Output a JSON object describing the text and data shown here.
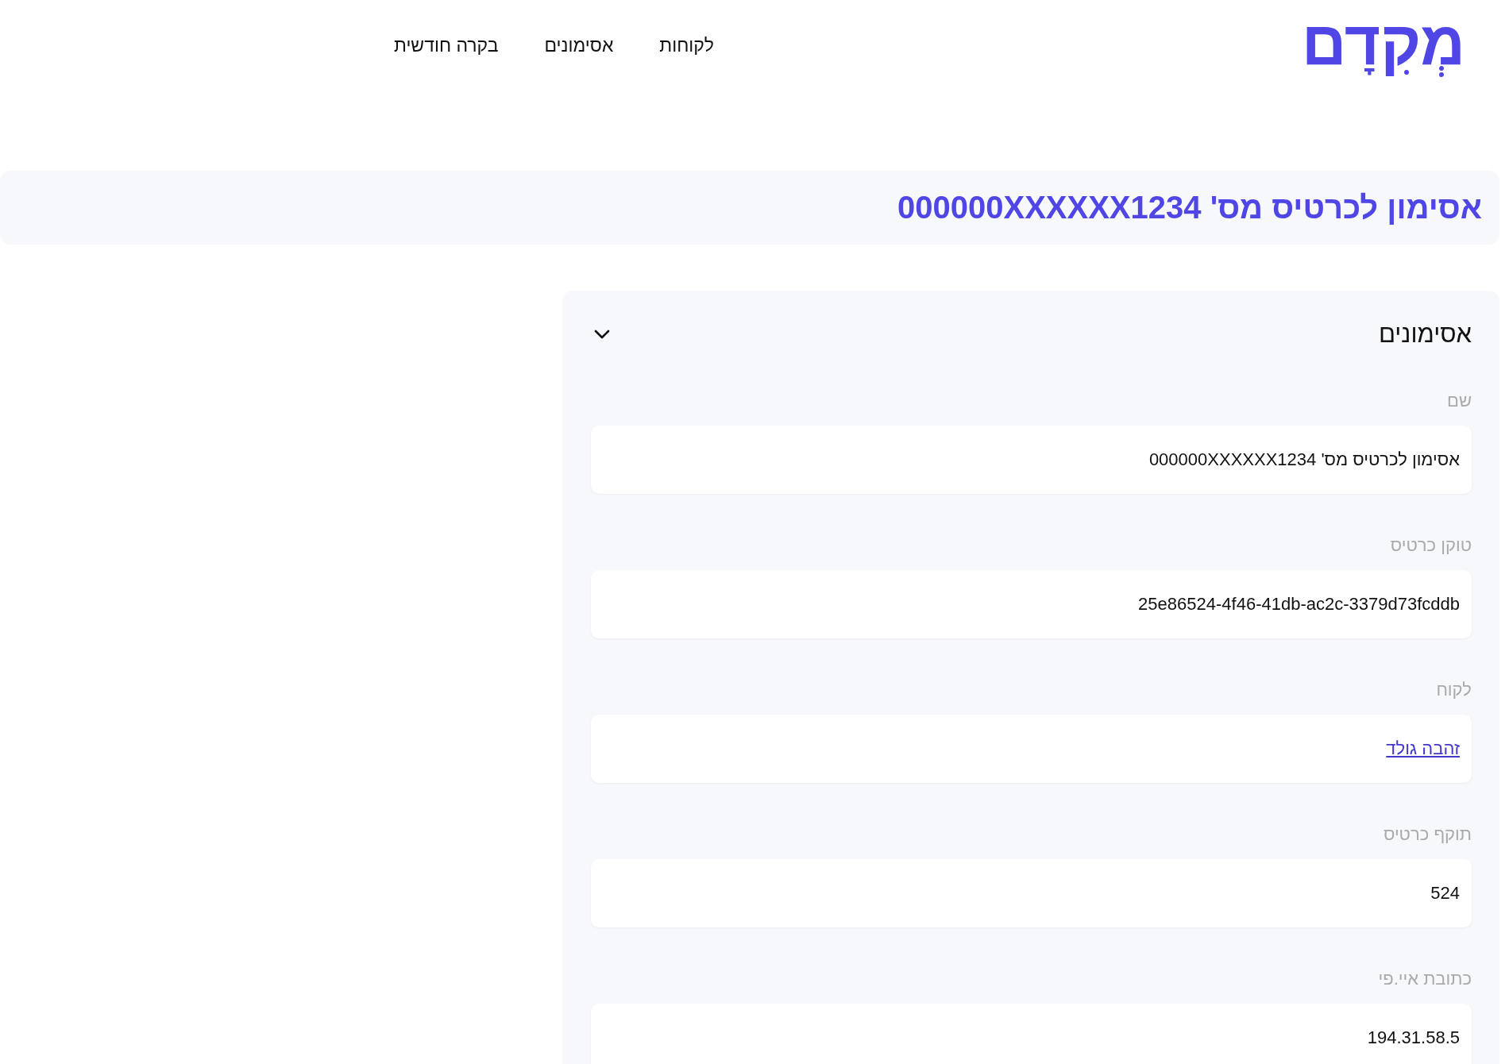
{
  "logo": {
    "text": "מְקִדָם"
  },
  "nav": [
    {
      "label": "לקוחות"
    },
    {
      "label": "אסימונים"
    },
    {
      "label": "בקרה חודשית"
    }
  ],
  "page_title": "אסימון לכרטיס מס' 000000XXXXXX1234",
  "panel": {
    "title": "אסימונים",
    "expanded": true,
    "fields": [
      {
        "kind": "text",
        "label": "שם",
        "value": "אסימון לכרטיס מס' 000000XXXXXX1234"
      },
      {
        "kind": "text",
        "label": "טוקן כרטיס",
        "value": "25e86524-4f46-41db-ac2c-3379d73fcddb"
      },
      {
        "kind": "link",
        "label": "לקוח",
        "value": "זהבה גולד"
      },
      {
        "kind": "text",
        "label": "תוקף כרטיס",
        "value": "524"
      },
      {
        "kind": "text",
        "label": "כתובת איי.פי",
        "value": "194.31.58.5"
      }
    ]
  }
}
